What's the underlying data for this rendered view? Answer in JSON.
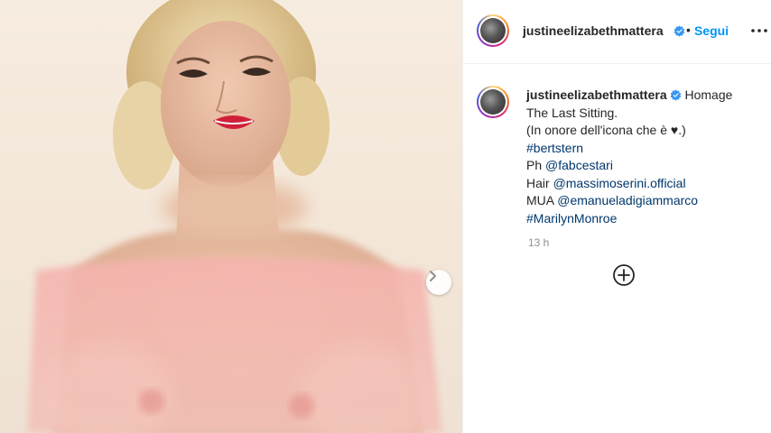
{
  "post": {
    "username": "justineelizabethmattera",
    "follow_label": "Segui",
    "dot": "•",
    "caption": {
      "first_text": "Homage",
      "line2": "The Last Sitting.",
      "line3": "(In onore dell'icona che è ♥.)",
      "hashtag1": "#bertstern",
      "ph_prefix": "Ph ",
      "ph_mention": "@fabcestari",
      "hair_prefix": "Hair ",
      "hair_mention": "@massimoserini.official",
      "mua_prefix": "MUA ",
      "mua_mention": "@emanueladigiammarco",
      "hashtag2": "#MarilynMonroe"
    },
    "time_ago": "13 h"
  },
  "icons": {
    "verified": "verified-badge-icon",
    "more": "more-options-icon",
    "next": "chevron-right-icon",
    "add": "plus-circle-icon"
  },
  "colors": {
    "link": "#00376b",
    "follow": "#0095f6",
    "verified": "#3897f0",
    "muted": "#8e8e8e"
  }
}
